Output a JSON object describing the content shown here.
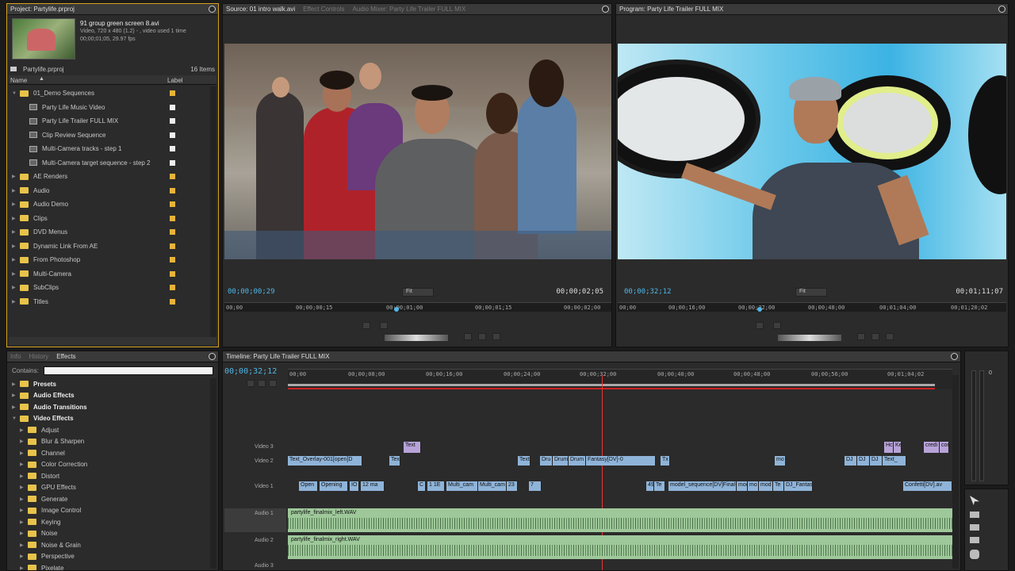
{
  "project": {
    "title": "Project: Partylife.prproj",
    "clip_name": "91 group green screen 8.avi",
    "clip_info1": "Video, 720 x 480 (1.2) - , video used 1 time",
    "clip_info2": "00;00;01;05, 29.97 fps",
    "file": "Partylife.prproj",
    "count": "16 Items",
    "col_name": "Name",
    "col_label": "Label",
    "items": [
      {
        "label": "01_Demo Sequences",
        "type": "folder",
        "indent": 0,
        "open": true
      },
      {
        "label": "Party Life Music Video",
        "type": "seq",
        "indent": 1
      },
      {
        "label": "Party Life Trailer FULL MIX",
        "type": "seq",
        "indent": 1
      },
      {
        "label": "Clip Review Sequence",
        "type": "seq",
        "indent": 1
      },
      {
        "label": "Multi-Camera tracks - step 1",
        "type": "seq",
        "indent": 1
      },
      {
        "label": "Multi-Camera target sequence - step 2",
        "type": "seq",
        "indent": 1
      },
      {
        "label": "AE Renders",
        "type": "folder",
        "indent": 0
      },
      {
        "label": "Audio",
        "type": "folder",
        "indent": 0
      },
      {
        "label": "Audio Demo",
        "type": "folder",
        "indent": 0
      },
      {
        "label": "Clips",
        "type": "folder",
        "indent": 0
      },
      {
        "label": "DVD Menus",
        "type": "folder",
        "indent": 0
      },
      {
        "label": "Dynamic Link From AE",
        "type": "folder",
        "indent": 0
      },
      {
        "label": "From Photoshop",
        "type": "folder",
        "indent": 0
      },
      {
        "label": "Multi-Camera",
        "type": "folder",
        "indent": 0
      },
      {
        "label": "SubClips",
        "type": "folder",
        "indent": 0
      },
      {
        "label": "Titles",
        "type": "folder",
        "indent": 0
      }
    ]
  },
  "effects": {
    "tabs": [
      "Info",
      "History",
      "Effects"
    ],
    "contains_label": "Contains:",
    "items": [
      {
        "label": "Presets",
        "bold": true,
        "indent": 0
      },
      {
        "label": "Audio Effects",
        "bold": true,
        "indent": 0
      },
      {
        "label": "Audio Transitions",
        "bold": true,
        "indent": 0
      },
      {
        "label": "Video Effects",
        "bold": true,
        "indent": 0,
        "open": true
      },
      {
        "label": "Adjust",
        "indent": 1
      },
      {
        "label": "Blur & Sharpen",
        "indent": 1
      },
      {
        "label": "Channel",
        "indent": 1
      },
      {
        "label": "Color Correction",
        "indent": 1
      },
      {
        "label": "Distort",
        "indent": 1
      },
      {
        "label": "GPU Effects",
        "indent": 1
      },
      {
        "label": "Generate",
        "indent": 1
      },
      {
        "label": "Image Control",
        "indent": 1
      },
      {
        "label": "Keying",
        "indent": 1
      },
      {
        "label": "Noise",
        "indent": 1
      },
      {
        "label": "Noise & Grain",
        "indent": 1
      },
      {
        "label": "Perspective",
        "indent": 1
      },
      {
        "label": "Pixelate",
        "indent": 1
      }
    ]
  },
  "source": {
    "tabs": [
      "Source: 01 intro walk.avi",
      "Effect Controls",
      "Audio Mixer: Party Life Trailer FULL MIX"
    ],
    "timecode": "00;00;00;29",
    "fit": "Fit",
    "duration": "00;00;02;05",
    "ruler": [
      "00;00",
      "00;00;00;15",
      "00;00;01;00",
      "00;00;01;15",
      "00;00;02;00"
    ]
  },
  "program": {
    "tabs": [
      "Program: Party Life Trailer FULL MIX"
    ],
    "timecode": "00;00;32;12",
    "fit": "Fit",
    "duration": "00;01;11;07",
    "ruler": [
      "00;00",
      "00;00;16;00",
      "00;00;32;00",
      "00;00;48;00",
      "00;01;04;00",
      "00;01;20;02"
    ]
  },
  "timeline": {
    "tab": "Timeline: Party Life Trailer FULL MIX",
    "timecode": "00;00;32;12",
    "ruler": [
      "00;00",
      "00;00;08;00",
      "00;00;16;00",
      "00;00;24;00",
      "00;00;32;00",
      "00;00;40;00",
      "00;00;48;00",
      "00;00;56;00",
      "00;01;04;02"
    ],
    "tracks": {
      "v3": "Video 3",
      "v2": "Video 2",
      "v1": "Video 1",
      "a1": "Audio 1",
      "a2": "Audio 2",
      "a3": "Audio 3"
    },
    "v3_clips": [
      "Text",
      "Hc",
      "Ke",
      "credi",
      "cor"
    ],
    "v2_clips": [
      "Text_Overlay-001[open]D",
      "Text",
      "Text",
      "Dru",
      "Drum",
      "Drum",
      "Fantasy[DV]-0",
      "Tx",
      "mo",
      "DJ",
      "DJ",
      "DJ",
      "Text_"
    ],
    "v1_clips": [
      "Open",
      "Opening",
      "IO",
      "12 ma",
      "C",
      "1 1E",
      "Multi_cam",
      "Multi_cam",
      "23",
      "7",
      "49",
      "Te",
      "model_sequence[DV]Final-00",
      "moc",
      "mo",
      "mod",
      "Te",
      "DJ_Fantasy_001",
      "Confetti[DV].av"
    ],
    "a1_clip": "partylife_finalmix_left.WAV",
    "a2_clip": "partylife_finalmix_right.WAV"
  },
  "meter": {
    "label": "0"
  }
}
